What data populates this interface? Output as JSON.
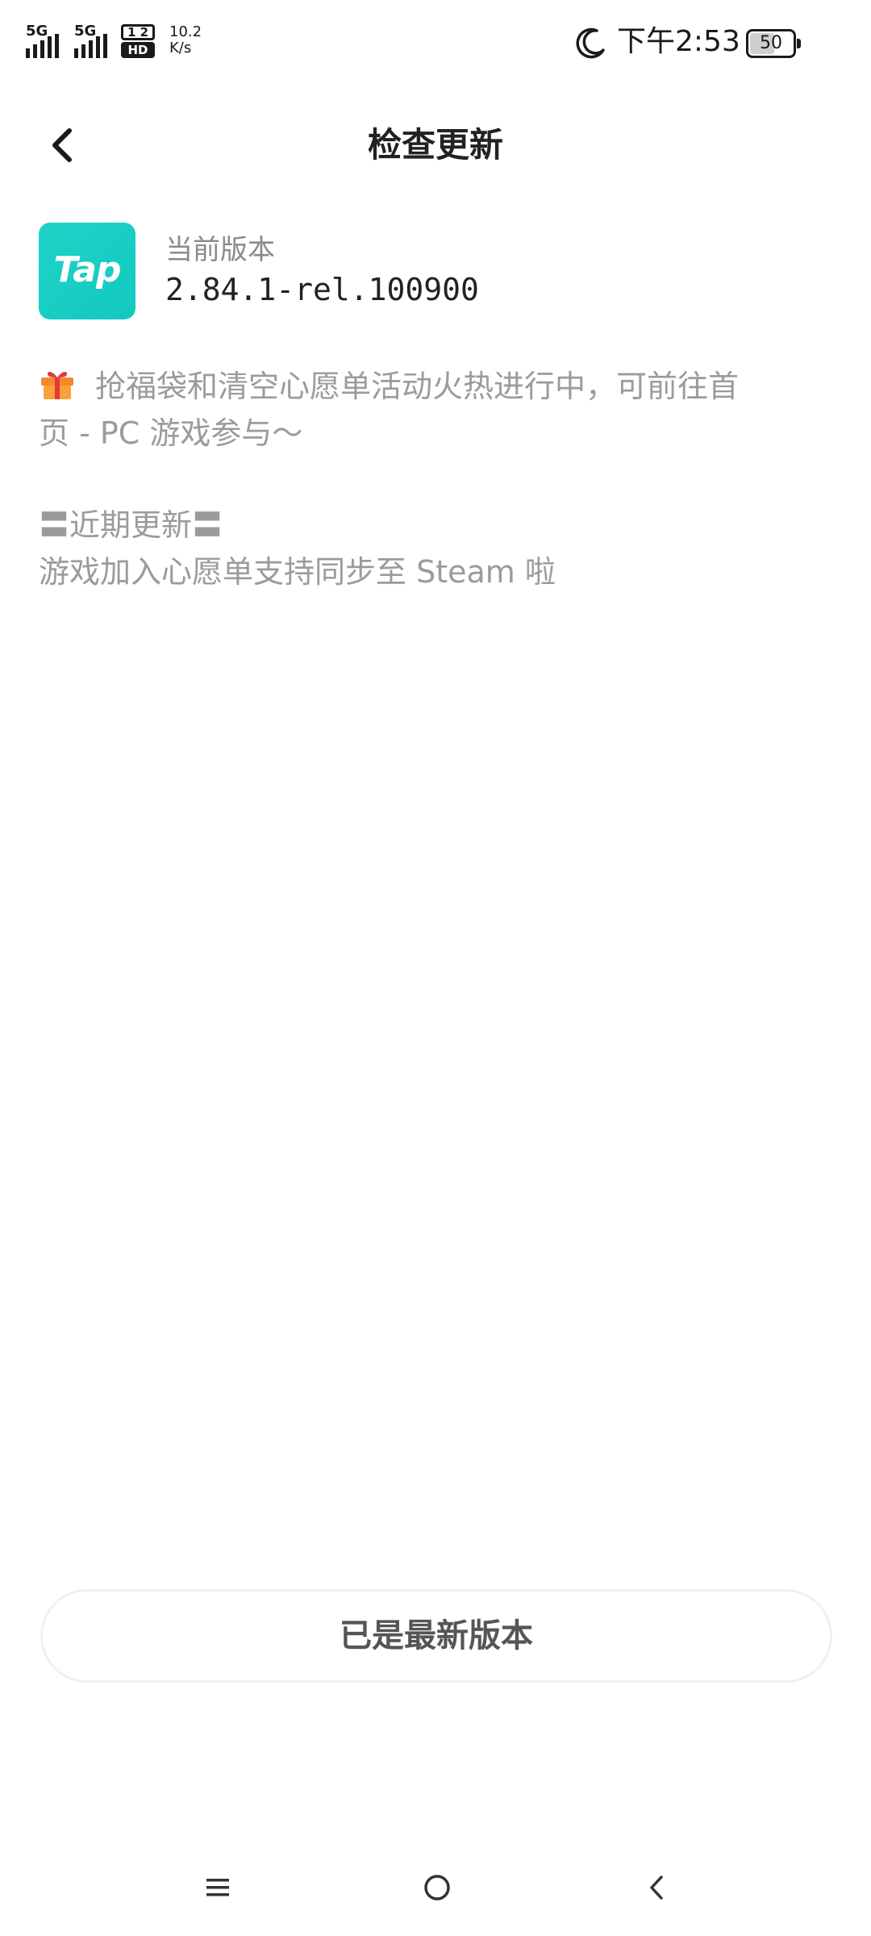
{
  "status_bar": {
    "signal1": "5G",
    "signal2": "5G",
    "hd_top": "1 2",
    "hd_bottom": "HD",
    "net_speed_value": "10.2",
    "net_speed_unit": "K/s",
    "time": "下午2:53",
    "battery": "50"
  },
  "header": {
    "title": "检查更新"
  },
  "app": {
    "logo_text": "Tap",
    "version_label": "当前版本",
    "version_value": "2.84.1-rel.100900"
  },
  "notes": {
    "promo_line1": "抢福袋和清空心愿单活动火热进行中，可前往首",
    "promo_line2": "页 - PC 游戏参与～",
    "section_title": "〓近期更新〓",
    "update_line": "游戏加入心愿单支持同步至 Steam 啦"
  },
  "button": {
    "label": "已是最新版本"
  },
  "colors": {
    "brand": "#17cfc4",
    "text_primary": "#222222",
    "text_secondary": "#9b9b9b"
  }
}
